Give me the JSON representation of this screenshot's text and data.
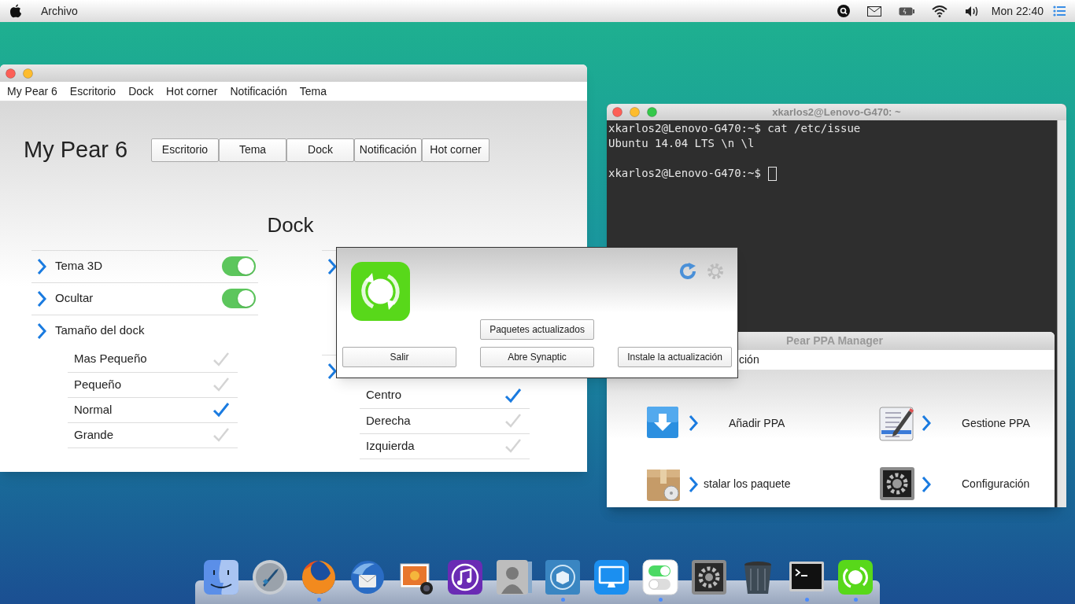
{
  "menu_bar": {
    "app_menu": "Archivo",
    "clock": "Mon 22:40"
  },
  "my_pear_window": {
    "menu": [
      "My Pear 6",
      "Escritorio",
      "Dock",
      "Hot corner",
      "Notificación",
      "Tema"
    ],
    "title": "My Pear 6",
    "sections": [
      "Escritorio",
      "Tema",
      "Dock",
      "Notificación",
      "Hot corner"
    ],
    "section_title": "Dock",
    "left_settings": [
      {
        "kind": "toggle",
        "label": "Tema 3D",
        "on": true
      },
      {
        "kind": "toggle",
        "label": "Ocultar",
        "on": true
      },
      {
        "kind": "group",
        "label": "Tamaño del dock",
        "options": [
          {
            "label": "Mas Pequeño",
            "checked": false
          },
          {
            "label": "Pequeño",
            "checked": false
          },
          {
            "label": "Normal",
            "checked": true
          },
          {
            "label": "Grande",
            "checked": false
          }
        ]
      }
    ],
    "right_settings": [
      {
        "kind": "row"
      },
      {
        "kind": "group",
        "options": [
          {
            "label": "Centro",
            "checked": true
          },
          {
            "label": "Derecha",
            "checked": false
          },
          {
            "label": "Izquierda",
            "checked": false
          }
        ]
      }
    ]
  },
  "terminal": {
    "title": "xkarlos2@Lenovo-G470: ~",
    "lines": [
      "xkarlos2@Lenovo-G470:~$ cat /etc/issue",
      "Ubuntu 14.04 LTS \\n \\l"
    ],
    "prompt": "xkarlos2@Lenovo-G470:~$"
  },
  "ppa_window": {
    "title": "Pear PPA Manager",
    "menu_item": "ción",
    "items": [
      {
        "label": "Añadir PPA"
      },
      {
        "label": "Gestione PPA"
      },
      {
        "label": "stalar los paquete"
      },
      {
        "label": "Configuración"
      }
    ]
  },
  "update_dialog": {
    "top_button": "Paquetes actualizados",
    "buttons": [
      "Salir",
      "Abre Synaptic",
      "Instale la actualización"
    ]
  },
  "dock": {
    "items": [
      {
        "running": false
      },
      {
        "running": false
      },
      {
        "running": true
      },
      {
        "running": false
      },
      {
        "running": false
      },
      {
        "running": false
      },
      {
        "running": false
      },
      {
        "running": true
      },
      {
        "running": false
      },
      {
        "running": true
      },
      {
        "running": false
      },
      {
        "running": false
      },
      {
        "running": true
      },
      {
        "running": true
      }
    ]
  }
}
